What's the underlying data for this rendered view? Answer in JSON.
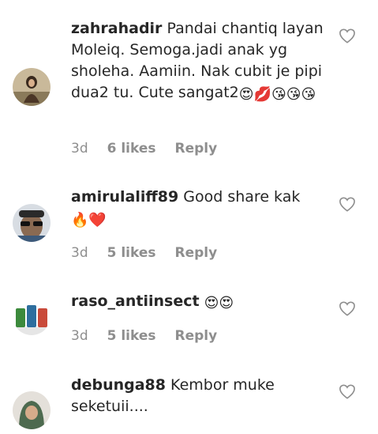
{
  "comments": [
    {
      "username": "zahrahadir",
      "text": " Pandai chantiq layan Moleiq. Semoga.jadi anak yg sholeha. Aamiin. Nak cubit je pipi dua2 tu. Cute sangat2",
      "emojis": "😍💋😘😘😘",
      "time": "3d",
      "likes": "6 likes",
      "reply": "Reply",
      "avatar": "woman-in-headscarf"
    },
    {
      "username": "amirulaliff89",
      "text": " Good share kak ",
      "emojis": "🔥❤️",
      "time": "3d",
      "likes": "5 likes",
      "reply": "Reply",
      "avatar": "man-with-sunglasses"
    },
    {
      "username": "raso_antiinsect",
      "text": " ",
      "emojis": "😍😍",
      "time": "3d",
      "likes": "5 likes",
      "reply": "Reply",
      "avatar": "product-bottles"
    },
    {
      "username": "debunga88",
      "text": " Kembor muke seketuii....",
      "emojis": "",
      "time": "",
      "likes": "",
      "reply": "",
      "avatar": "woman-in-hijab"
    }
  ],
  "icons": {
    "like": "heart-outline-icon"
  },
  "colors": {
    "text": "#262626",
    "meta": "#8e8e8e"
  }
}
